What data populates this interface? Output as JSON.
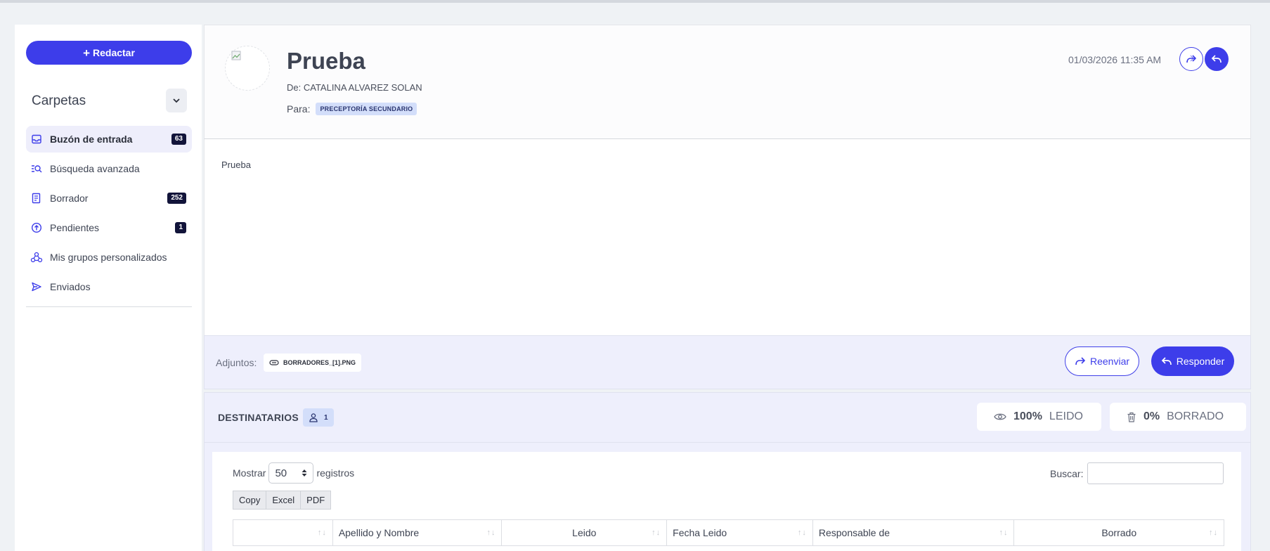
{
  "sidebar": {
    "compose_label": "Redactar",
    "folders_title": "Carpetas",
    "items": [
      {
        "label": "Buzón de entrada",
        "badge": "63",
        "icon": "inbox-icon"
      },
      {
        "label": "Búsqueda avanzada",
        "badge": "",
        "icon": "advanced-search-icon"
      },
      {
        "label": "Borrador",
        "badge": "252",
        "icon": "draft-icon"
      },
      {
        "label": "Pendientes",
        "badge": "1",
        "icon": "pending-icon"
      },
      {
        "label": "Mis grupos personalizados",
        "badge": "",
        "icon": "groups-icon"
      },
      {
        "label": "Enviados",
        "badge": "",
        "icon": "send-icon"
      }
    ]
  },
  "message": {
    "subject": "Prueba",
    "from": "De: CATALINA ALVAREZ SOLAN",
    "to_label": "Para:",
    "to_tag": "PRECEPTORÍA SECUNDARIO",
    "date": "01/03/2026 11:35 AM",
    "body": "Prueba"
  },
  "attachments": {
    "label": "Adjuntos:",
    "file": "BORRADORES_[1].PNG",
    "forward_label": "Reenviar",
    "reply_label": "Responder"
  },
  "recipients": {
    "title": "DESTINATARIOS",
    "count": "1",
    "read_pct": "100%",
    "read_label": "LEIDO",
    "deleted_pct": "0%",
    "deleted_label": "BORRADO"
  },
  "table": {
    "show_label": "Mostrar",
    "page_size": "50",
    "records_label": "registros",
    "search_label": "Buscar:",
    "export_buttons": [
      "Copy",
      "Excel",
      "PDF"
    ],
    "columns": [
      "",
      "Apellido y Nombre",
      "Leido",
      "Fecha Leido",
      "Responsable de",
      "Borrado"
    ]
  },
  "colors": {
    "accent": "#3d3dea",
    "badge_bg": "#12143a",
    "tag_bg": "#d3defa"
  }
}
